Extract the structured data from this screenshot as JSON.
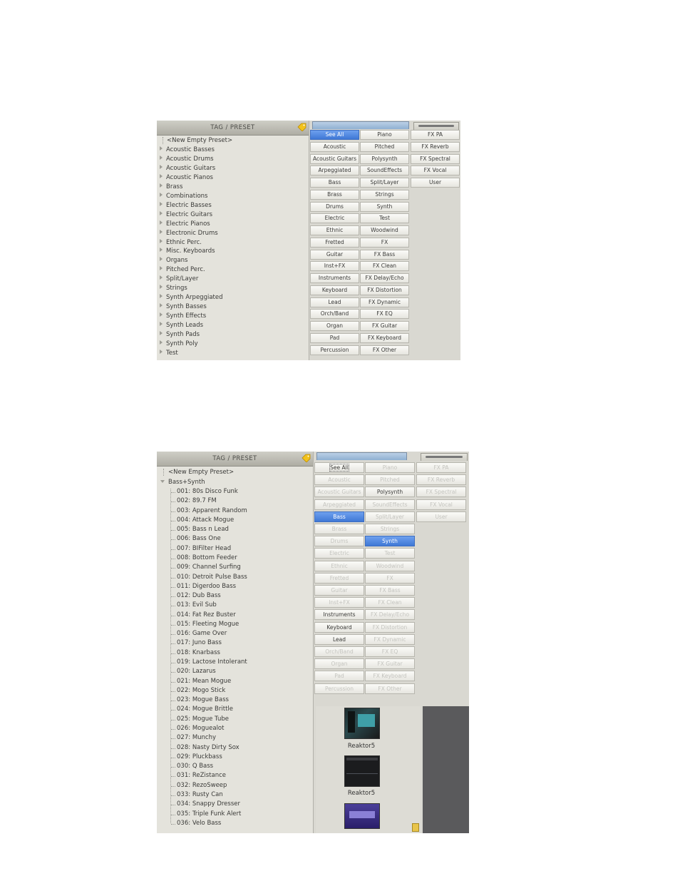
{
  "shot1": {
    "header": "TAG / PRESET",
    "new_preset": "<New Empty Preset>",
    "tags": [
      "Acoustic Basses",
      "Acoustic Drums",
      "Acoustic Guitars",
      "Acoustic Pianos",
      "Brass",
      "Combinations",
      "Electric Basses",
      "Electric Guitars",
      "Electric Pianos",
      "Electronic Drums",
      "Ethnic Perc.",
      "Misc. Keyboards",
      "Organs",
      "Pitched Perc.",
      "Split/Layer",
      "Strings",
      "Synth Arpeggiated",
      "Synth Basses",
      "Synth Effects",
      "Synth Leads",
      "Synth Pads",
      "Synth Poly",
      "Test"
    ],
    "col1": [
      "See All",
      "Acoustic",
      "Acoustic Guitars",
      "Arpeggiated",
      "Bass",
      "Brass",
      "Drums",
      "Electric",
      "Ethnic",
      "Fretted",
      "Guitar",
      "Inst+FX",
      "Instruments",
      "Keyboard",
      "Lead",
      "Orch/Band",
      "Organ",
      "Pad",
      "Percussion"
    ],
    "col2": [
      "Piano",
      "Pitched",
      "Polysynth",
      "SoundEffects",
      "Split/Layer",
      "Strings",
      "Synth",
      "Test",
      "Woodwind",
      "FX",
      "FX Bass",
      "FX Clean",
      "FX Delay/Echo",
      "FX Distortion",
      "FX Dynamic",
      "FX EQ",
      "FX Guitar",
      "FX Keyboard",
      "FX Other"
    ],
    "col3": [
      "FX PA",
      "FX Reverb",
      "FX Spectral",
      "FX Vocal",
      "User"
    ],
    "selected": "See All"
  },
  "shot2": {
    "header": "TAG / PRESET",
    "new_preset": "<New Empty Preset>",
    "group": "Bass+Synth",
    "presets": [
      {
        "num": "001",
        "name": "80s Disco Funk"
      },
      {
        "num": "002",
        "name": "89.7 FM"
      },
      {
        "num": "003",
        "name": "Apparent Random"
      },
      {
        "num": "004",
        "name": "Attack Mogue"
      },
      {
        "num": "005",
        "name": "Bass n Lead"
      },
      {
        "num": "006",
        "name": "Bass One"
      },
      {
        "num": "007",
        "name": "BIFilter Head"
      },
      {
        "num": "008",
        "name": "Bottom Feeder"
      },
      {
        "num": "009",
        "name": "Channel Surfing"
      },
      {
        "num": "010",
        "name": "Detroit Pulse  Bass"
      },
      {
        "num": "011",
        "name": "Digerdoo Bass"
      },
      {
        "num": "012",
        "name": "Dub Bass"
      },
      {
        "num": "013",
        "name": "Evil Sub"
      },
      {
        "num": "014",
        "name": "Fat Rez Buster"
      },
      {
        "num": "015",
        "name": "Fleeting Mogue"
      },
      {
        "num": "016",
        "name": "Game Over"
      },
      {
        "num": "017",
        "name": "Juno Bass"
      },
      {
        "num": "018",
        "name": "Knarbass"
      },
      {
        "num": "019",
        "name": "Lactose Intolerant"
      },
      {
        "num": "020",
        "name": "Lazarus"
      },
      {
        "num": "021",
        "name": "Mean Mogue"
      },
      {
        "num": "022",
        "name": "Mogo Stick"
      },
      {
        "num": "023",
        "name": "Mogue Bass"
      },
      {
        "num": "024",
        "name": "Mogue Brittle"
      },
      {
        "num": "025",
        "name": "Mogue Tube"
      },
      {
        "num": "026",
        "name": "Moguealot"
      },
      {
        "num": "027",
        "name": "Munchy"
      },
      {
        "num": "028",
        "name": "Nasty Dirty Sox"
      },
      {
        "num": "029",
        "name": "Pluckbass"
      },
      {
        "num": "030",
        "name": "Q Bass"
      },
      {
        "num": "031",
        "name": "ReZistance"
      },
      {
        "num": "032",
        "name": "RezoSweep"
      },
      {
        "num": "033",
        "name": "Rusty Can"
      },
      {
        "num": "034",
        "name": "Snappy Dresser"
      },
      {
        "num": "035",
        "name": "Triple Funk Alert"
      },
      {
        "num": "036",
        "name": "Velo Bass"
      }
    ],
    "col1": [
      "See All",
      "Acoustic",
      "Acoustic Guitars",
      "Arpeggiated",
      "Bass",
      "Brass",
      "Drums",
      "Electric",
      "Ethnic",
      "Fretted",
      "Guitar",
      "Inst+FX",
      "Instruments",
      "Keyboard",
      "Lead",
      "Orch/Band",
      "Organ",
      "Pad",
      "Percussion"
    ],
    "col2": [
      "Piano",
      "Pitched",
      "Polysynth",
      "SoundEffects",
      "Split/Layer",
      "Strings",
      "Synth",
      "Test",
      "Woodwind",
      "FX",
      "FX Bass",
      "FX Clean",
      "FX Delay/Echo",
      "FX Distortion",
      "FX Dynamic",
      "FX EQ",
      "FX Guitar",
      "FX Keyboard",
      "FX Other"
    ],
    "col3": [
      "FX PA",
      "FX Reverb",
      "FX Spectral",
      "FX Vocal",
      "User"
    ],
    "active": [
      "See All",
      "Polysynth",
      "Bass",
      "Synth",
      "Instruments",
      "Keyboard",
      "Lead"
    ],
    "selected": [
      "Bass",
      "Synth"
    ],
    "focused": "See All",
    "plugins": [
      "Reaktor5",
      "Reaktor5"
    ]
  }
}
